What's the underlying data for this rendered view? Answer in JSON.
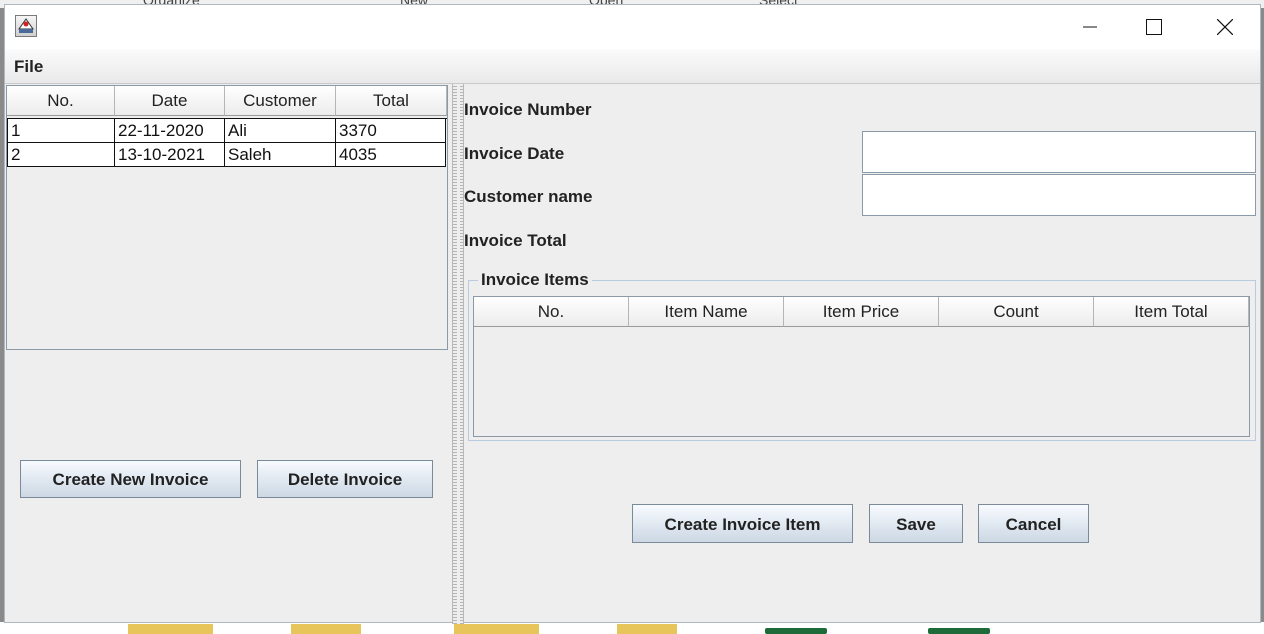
{
  "background": {
    "explorer_labels": [
      "Organize",
      "New",
      "Open",
      "Select"
    ]
  },
  "window": {
    "icon": "java-app-icon",
    "controls": {
      "minimize_icon": "minimize-icon",
      "maximize_icon": "maximize-icon",
      "close_icon": "close-icon"
    }
  },
  "menu": {
    "file_label": "File"
  },
  "invoices_table": {
    "headers": [
      "No.",
      "Date",
      "Customer",
      "Total"
    ],
    "rows": [
      {
        "no": "1",
        "date": "22-11-2020",
        "customer": "Ali",
        "total": "3370"
      },
      {
        "no": "2",
        "date": "13-10-2021",
        "customer": "Saleh",
        "total": "4035"
      }
    ]
  },
  "left_buttons": {
    "create_label": "Create New Invoice",
    "delete_label": "Delete Invoice"
  },
  "details": {
    "invoice_number_label": "Invoice Number",
    "invoice_number_value": "",
    "invoice_date_label": "Invoice Date",
    "invoice_date_value": "",
    "customer_name_label": "Customer name",
    "customer_name_value": "",
    "invoice_total_label": "Invoice Total",
    "invoice_total_value": ""
  },
  "items_group": {
    "title": "Invoice Items",
    "headers": [
      "No.",
      "Item Name",
      "Item Price",
      "Count",
      "Item Total"
    ]
  },
  "right_buttons": {
    "create_item_label": "Create Invoice Item",
    "save_label": "Save",
    "cancel_label": "Cancel"
  },
  "colors": {
    "window_bg": "#eeeeee",
    "table_border": "#8c9aa7",
    "button_top": "#f8fbff",
    "button_bottom": "#cdd8e4"
  }
}
